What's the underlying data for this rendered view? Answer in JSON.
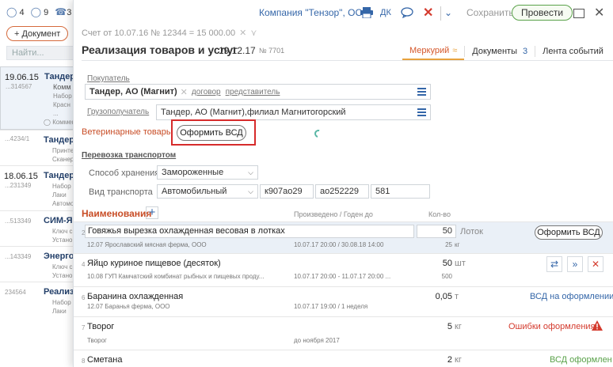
{
  "background": {
    "top": {
      "chats": "4",
      "msgs": "9",
      "partial": "3"
    },
    "add_button": "+ Документ",
    "search_placeholder": "Найти...",
    "rows": [
      {
        "date": "19.06.15",
        "num": "...314567",
        "title": "Тандер,",
        "lines": [
          "Комм",
          "Набор",
          "Красн",
          "..."
        ],
        "note": "Коммен"
      },
      {
        "date": "",
        "num": "...4234/1",
        "title": "Тандер,",
        "lines": [
          "Принте",
          "Сканер"
        ],
        "note": ""
      },
      {
        "date": "18.06.15",
        "num": "...231349",
        "title": "Тандер,",
        "lines": [
          "Набор",
          "Лаки",
          "Автомо"
        ],
        "note": ""
      },
      {
        "date": "",
        "num": "...513349",
        "title": "СИМ-ЯР",
        "lines": [
          "Ключ с",
          "Устано"
        ],
        "note": ""
      },
      {
        "date": "",
        "num": "...143349",
        "title": "Энергог",
        "lines": [
          "Ключ с",
          "Устано"
        ],
        "note": ""
      },
      {
        "date": "",
        "num": "234564",
        "title": "Реализ",
        "lines": [
          "Набор",
          "Лаки"
        ],
        "note": ""
      }
    ]
  },
  "toolbar": {
    "company": "Компания \"Тензор\", ООО",
    "dk": "ДК",
    "save": "Сохранить",
    "provesti": "Провести"
  },
  "ref": "Счет от 10.07.16 № 12344 = 15 000.00",
  "doc": {
    "title": "Реализация товаров и услуг",
    "date": "19.12.17",
    "num": "№ 7701"
  },
  "tabs": [
    {
      "label": "Меркурий",
      "count": ""
    },
    {
      "label": "Документы",
      "count": "3"
    },
    {
      "label": "Лента событий",
      "count": ""
    }
  ],
  "buyer": {
    "label": "Покупатель",
    "value": "Тандер, АО (Магнит)",
    "link_contract": "договор",
    "link_rep": "представитель"
  },
  "consignee": {
    "label": "Грузополучатель",
    "value": "Тандер, АО (Магнит),филиал Магнитогорский"
  },
  "vet": {
    "title": "Ветеринарные товары",
    "button": "Оформить ВСД"
  },
  "transport": {
    "title": "Перевозка транспортом",
    "storage_label": "Способ хранения",
    "storage_value": "Замороженные",
    "type_label": "Вид транспорта",
    "type_value": "Автомобильный",
    "num1": "к907ао29",
    "num2": "ао252229",
    "num3": "581"
  },
  "names": {
    "title": "Наименования",
    "col_dates": "Произведено / Годен до",
    "col_qty": "Кол-во"
  },
  "items": [
    {
      "n": "2",
      "name": "Говяжья вырезка охлажденная весовая в лотках",
      "sup": "12.07 Ярославский мясная ферма, ООО",
      "dates": "10.07.17 20:00 / 30.08.18 14:00",
      "qty": "50",
      "unit": "Лоток",
      "subqty": "25",
      "subunit": "кг",
      "button": "Оформить ВСД"
    },
    {
      "n": "4",
      "name": "Яйцо куриное пищевое (десяток)",
      "sup": "10.08 ГУП Камчатский комбинат рыбных и пищевых проду...",
      "dates": "10.07.17 20:00 - 11.07.17 20:00 ...",
      "qty": "50",
      "unit": "шт",
      "subqty": "500"
    },
    {
      "n": "6",
      "name": "Баранина охлажденная",
      "sup": "12.07 Баранья ферма, ООО",
      "dates": "10.07.17 19:00 / 1 неделя",
      "qty": "0,05",
      "unit": "т",
      "status": "ВСД на оформлении"
    },
    {
      "n": "7",
      "name": "Творог",
      "sup": "Творог",
      "dates": "до ноября 2017",
      "qty": "5",
      "unit": "кг",
      "status": "Ошибки оформления"
    },
    {
      "n": "8",
      "name": "Сметана",
      "qty": "2",
      "unit": "кг",
      "status": "ВСД оформлен"
    }
  ],
  "colors": {
    "accent": "#d5572b",
    "link": "#3466a8",
    "error": "#d43b2e",
    "ok": "#5aa24a",
    "highlight": "#d62b2b"
  }
}
